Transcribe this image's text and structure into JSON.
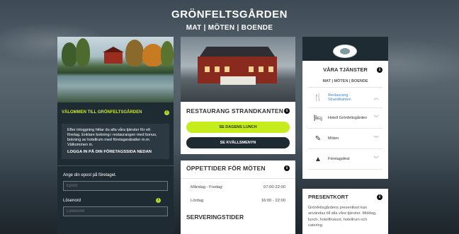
{
  "header": {
    "title": "GRÖNFELTSGÅRDEN",
    "subtitle": "MAT | MÖTEN | BOENDE"
  },
  "left": {
    "welcome": "VÄLOMMEN TILL GRÖNFELTSGÅRDEN",
    "info_icon": "i",
    "intro": "Efter inloggning hittar du alla våra tjänster för ett företag. Enklare bokning i restaurangen med bonus, bokning av hotellrum med företagsrabatter m.m. Välkommen in.",
    "login_hint": "LOGGA IN PÅ DIN FÖRETAGSSIDA NEDAN",
    "email_label": "Ange din epost på företaget.",
    "email_placeholder": "Epost",
    "password_label": "Lösenord",
    "password_placeholder": "Lösenord"
  },
  "restaurant": {
    "title": "RESTAURANG STRANDKANTEN",
    "btn_lunch": "SE DAGENS LUNCH",
    "btn_evening": "SE KVÄLLSMENYN"
  },
  "hours": {
    "title": "ÖPPETTIDER FÖR MÖTEN",
    "rows": [
      {
        "day": "Måndag - Fredag:",
        "time": "07:00-22:00"
      },
      {
        "day": "Lördag",
        "time": "16:00 - 22:00"
      }
    ],
    "serving_title": "SERVERINGSTIDER"
  },
  "services": {
    "title": "VÅRA TJÄNSTER",
    "subtitle": "MAT | MÖTEN | BOENDE",
    "items": [
      {
        "label": "Restaurang Strandkanten",
        "icon": "cutlery-icon",
        "glyph": "🍴",
        "chevron": "︿"
      },
      {
        "label": "Hotell Grönfeltsgården",
        "icon": "bed-icon",
        "glyph": "🛏",
        "chevron": "﹀"
      },
      {
        "label": "Möten",
        "icon": "edit-icon",
        "glyph": "✎",
        "chevron": "﹀"
      },
      {
        "label": "Företagsfest",
        "icon": "party-icon",
        "glyph": "▲",
        "chevron": "﹀"
      }
    ]
  },
  "giftcard": {
    "title": "PRESENTKORT",
    "text": "Grönfeltsgårdens presentkort kan användas till alla våra tjänster. Middag, lunch, hotellfrukost, hotellrum och catering."
  },
  "colors": {
    "accent_lime": "#c7ec1e",
    "dark_panel": "#1f2b33",
    "active_blue": "#3a87c8"
  }
}
